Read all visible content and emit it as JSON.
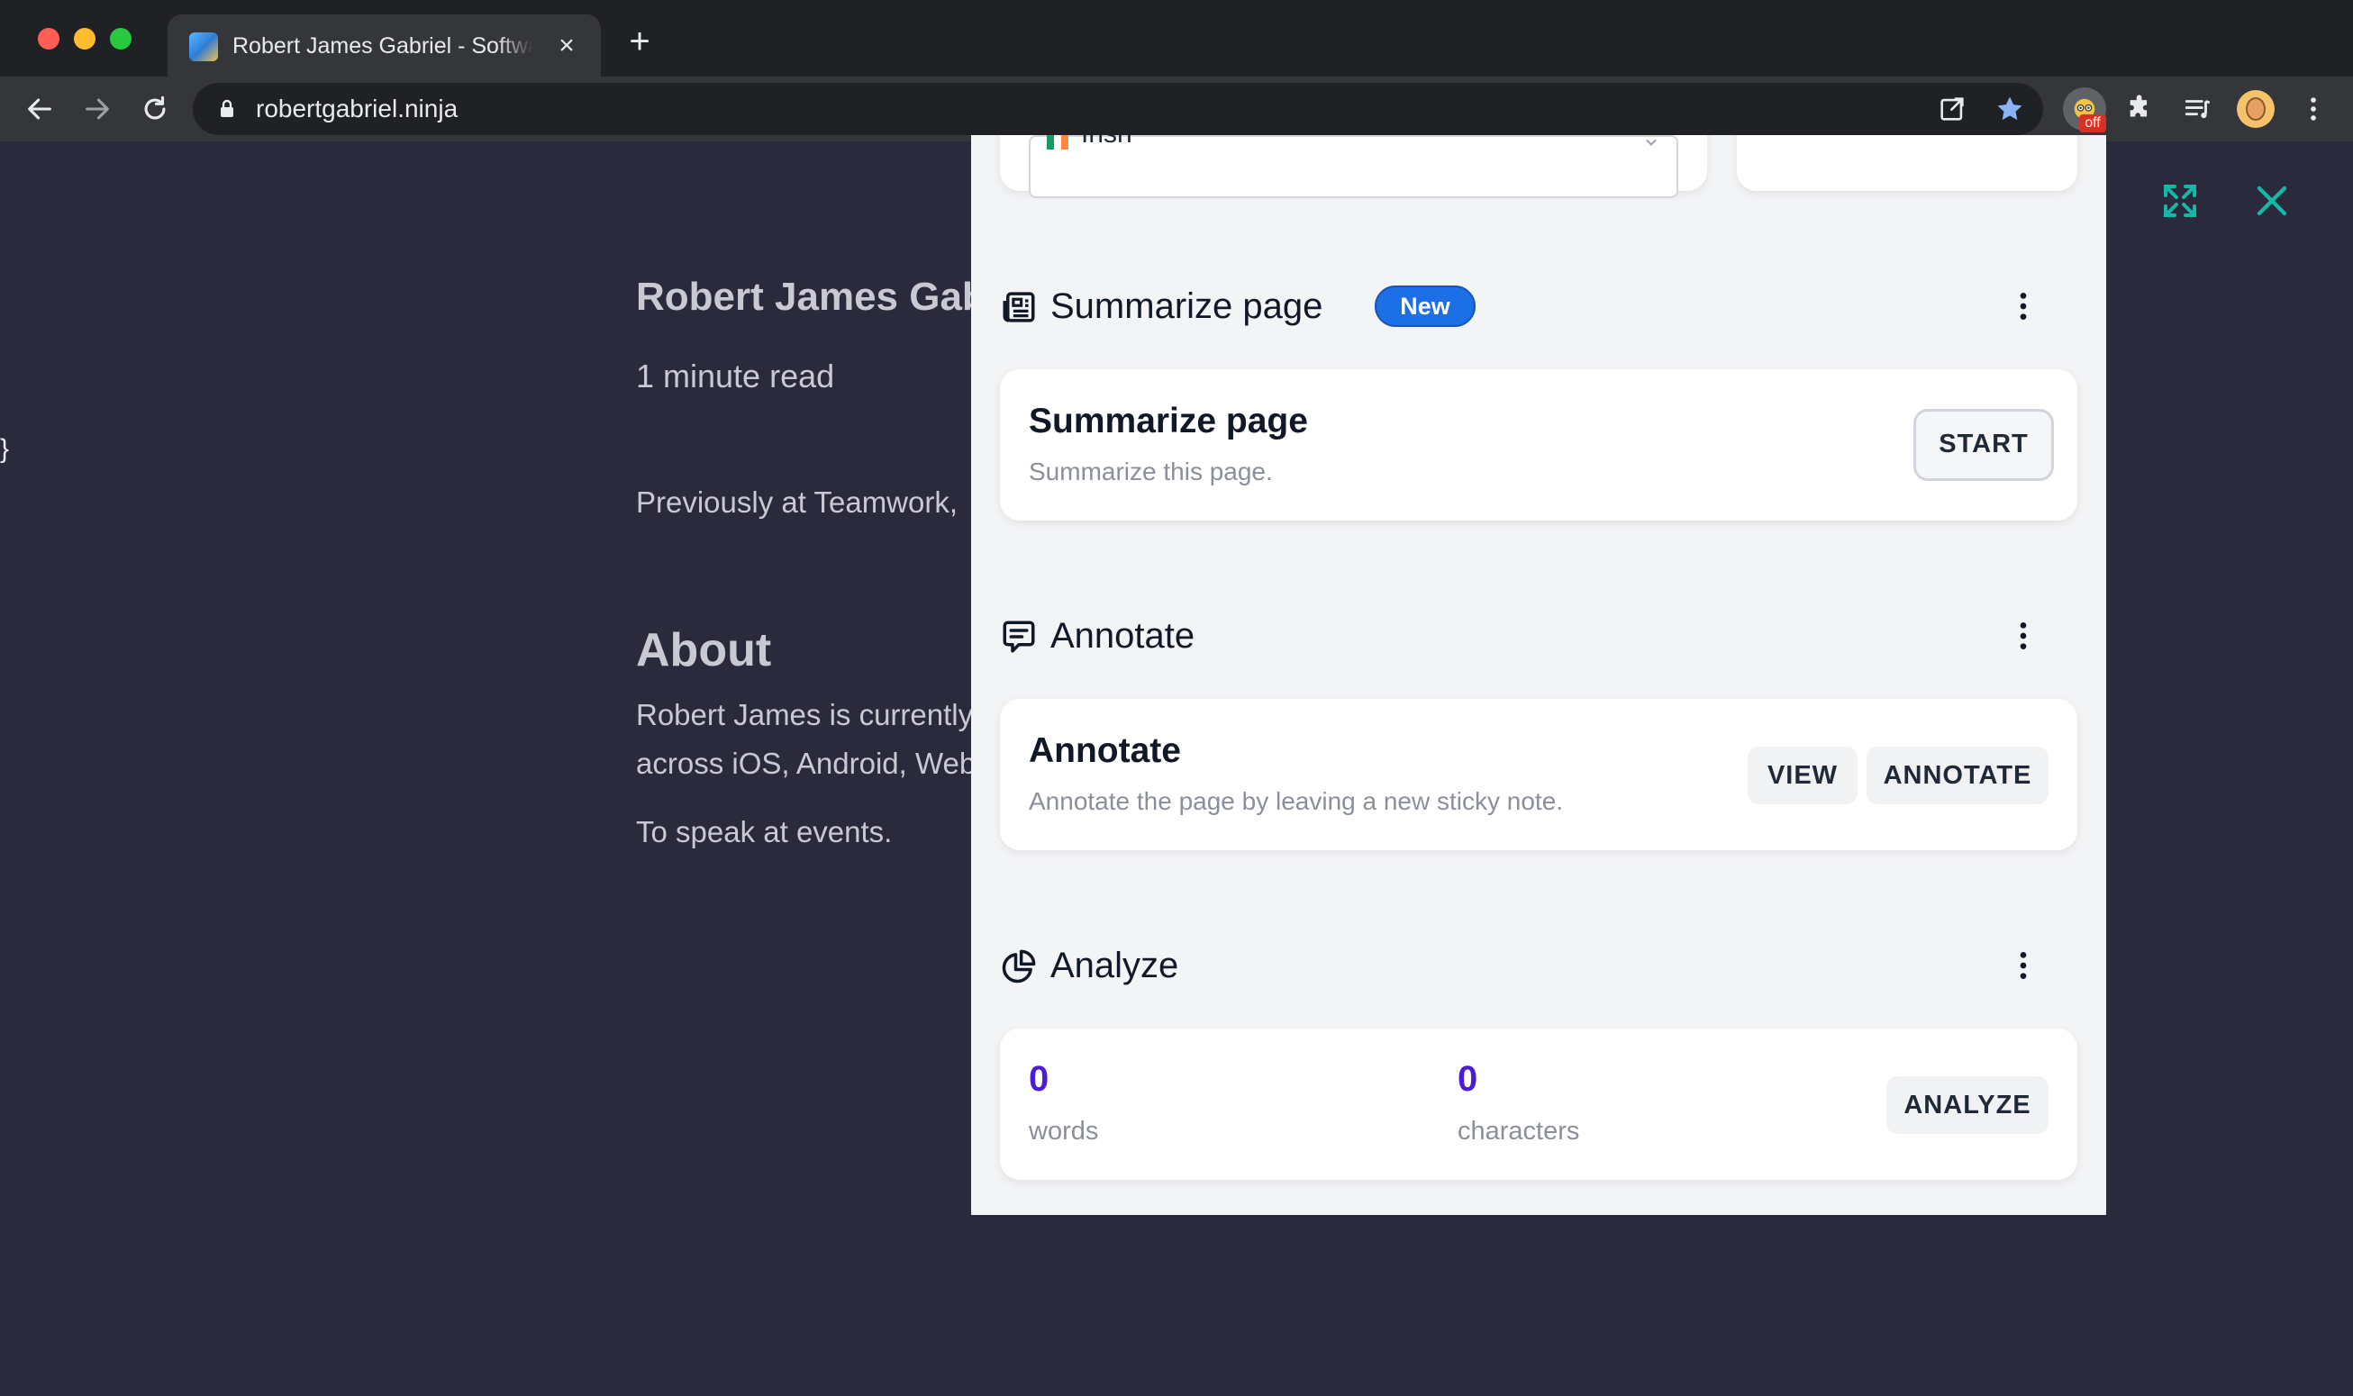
{
  "browser": {
    "tab_title": "Robert James Gabriel - Software Engineer",
    "tab_close": "×",
    "new_tab": "+",
    "url": "robertgabriel.ninja",
    "extension_badge": "off"
  },
  "page": {
    "brace": "}",
    "site_title": "Robert James Gabriel - Software Engineer",
    "read_time": "1 minute read",
    "previously": "Previously at  Teamwork,",
    "about_heading": "About",
    "about_line1": "Robert James is currently",
    "about_line2": "across iOS, Android, Web",
    "about_line3": "To speak at events."
  },
  "panel": {
    "language_value": "Irish",
    "summarize": {
      "section_title": "Summarize page",
      "badge": "New",
      "card_title": "Summarize page",
      "card_sub": "Summarize this page.",
      "start_label": "START"
    },
    "annotate": {
      "section_title": "Annotate",
      "card_title": "Annotate",
      "card_sub": "Annotate the page by leaving a new sticky note.",
      "view_label": "VIEW",
      "annotate_label": "ANNOTATE"
    },
    "analyze": {
      "section_title": "Analyze",
      "words_count": "0",
      "words_label": "words",
      "chars_count": "0",
      "chars_label": "characters",
      "analyze_label": "ANALYZE"
    }
  },
  "colors": {
    "accent_teal": "#14b8a6",
    "badge_blue": "#1d6fe5",
    "stat_purple": "#4c1bd6",
    "page_bg": "#2b2a3c"
  },
  "icons": {
    "back": "arrow-left-icon",
    "forward": "arrow-right-icon",
    "reload": "reload-icon",
    "lock": "lock-icon",
    "open_external": "open-external-icon",
    "bookmark": "star-icon",
    "extensions": "puzzle-icon",
    "media": "media-queue-icon",
    "profile": "avatar",
    "menu": "kebab-icon",
    "expand": "expand-icon",
    "close": "close-icon",
    "summarize": "newspaper-icon",
    "annotate": "comment-icon",
    "analyze": "pie-chart-icon"
  }
}
